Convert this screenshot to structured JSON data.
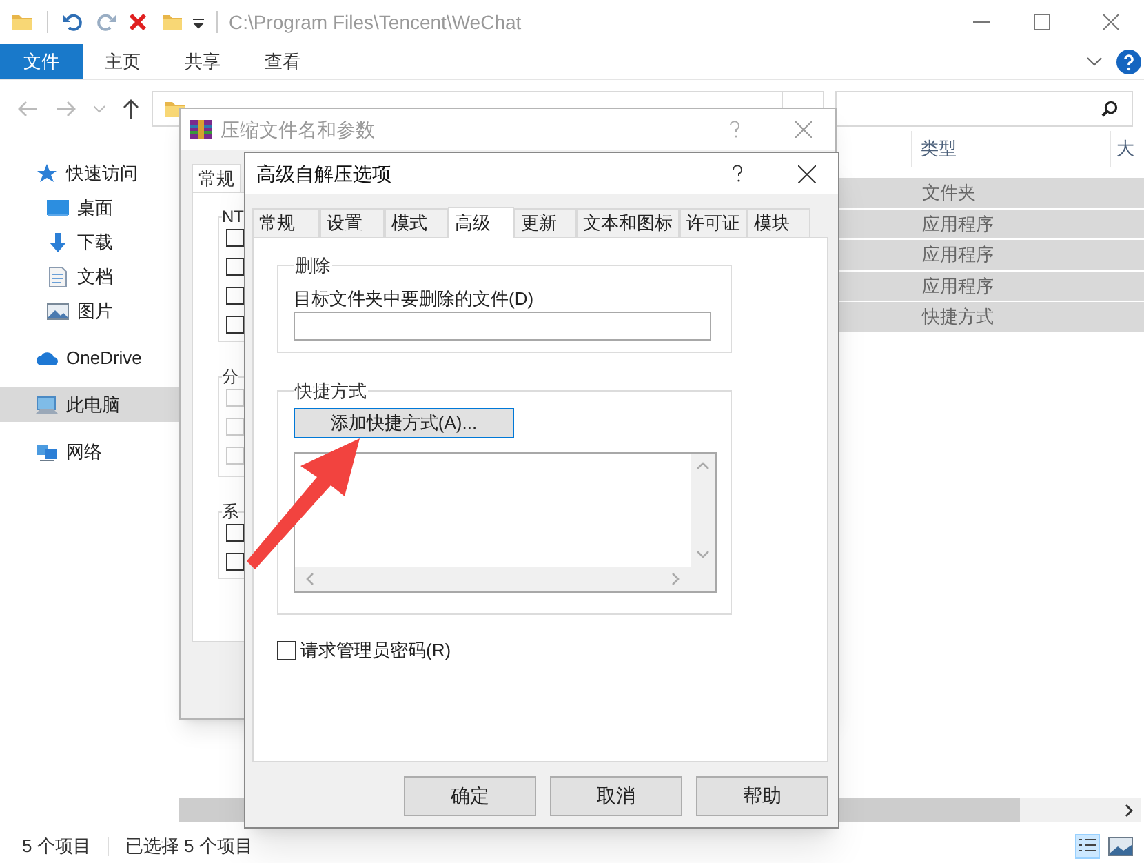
{
  "explorer": {
    "title_path": "C:\\Program Files\\Tencent\\WeChat",
    "ribbon_tabs": [
      {
        "label": "文件",
        "selected": true
      },
      {
        "label": "主页",
        "selected": false
      },
      {
        "label": "共享",
        "selected": false
      },
      {
        "label": "查看",
        "selected": false
      }
    ],
    "sidebar": [
      {
        "label": "快速访问",
        "kind": "star",
        "selected": false,
        "children": [
          {
            "label": "桌面",
            "kind": "desktop",
            "selected": false
          },
          {
            "label": "下载",
            "kind": "download",
            "selected": false
          },
          {
            "label": "文档",
            "kind": "document",
            "selected": false
          },
          {
            "label": "图片",
            "kind": "pictures",
            "selected": false
          }
        ]
      },
      {
        "label": "OneDrive",
        "kind": "cloud",
        "selected": false
      },
      {
        "label": "此电脑",
        "kind": "computer",
        "selected": true
      },
      {
        "label": "网络",
        "kind": "network",
        "selected": false
      }
    ],
    "columns": [
      "类型",
      "大"
    ],
    "rows": [
      {
        "type": "文件夹",
        "selected": true
      },
      {
        "type": "应用程序",
        "selected": true
      },
      {
        "type": "应用程序",
        "selected": true
      },
      {
        "type": "应用程序",
        "selected": true
      },
      {
        "type": "快捷方式",
        "selected": true
      }
    ],
    "status": {
      "count": "5 个项目",
      "selection": "已选择 5 个项目"
    }
  },
  "archive_dialog": {
    "title": "压缩文件名和参数",
    "tab": "常规",
    "groups": [
      {
        "label": "NT",
        "checkboxes": [
          {
            "checked": false,
            "disabled": false
          },
          {
            "checked": false,
            "disabled": false
          },
          {
            "checked": false,
            "disabled": false
          },
          {
            "checked": false,
            "disabled": false
          }
        ]
      },
      {
        "label": "分",
        "checkboxes": [
          {
            "checked": false,
            "disabled": true
          },
          {
            "checked": false,
            "disabled": true
          },
          {
            "checked": false,
            "disabled": true
          }
        ]
      },
      {
        "label": "系",
        "checkboxes": [
          {
            "checked": false,
            "disabled": false
          },
          {
            "checked": false,
            "disabled": false
          }
        ]
      }
    ]
  },
  "sfx_dialog": {
    "title": "高级自解压选项",
    "tabs": [
      {
        "label": "常规",
        "selected": false
      },
      {
        "label": "设置",
        "selected": false
      },
      {
        "label": "模式",
        "selected": false
      },
      {
        "label": "高级",
        "selected": true
      },
      {
        "label": "更新",
        "selected": false
      },
      {
        "label": "文本和图标",
        "selected": false
      },
      {
        "label": "许可证",
        "selected": false
      },
      {
        "label": "模块",
        "selected": false
      }
    ],
    "delete_group": {
      "title": "删除",
      "field_label": "目标文件夹中要删除的文件(D)"
    },
    "shortcut_group": {
      "title": "快捷方式",
      "button": "添加快捷方式(A)..."
    },
    "admin_password": {
      "label": "请求管理员密码(R)",
      "checked": false
    },
    "buttons": [
      "确定",
      "取消",
      "帮助"
    ]
  }
}
